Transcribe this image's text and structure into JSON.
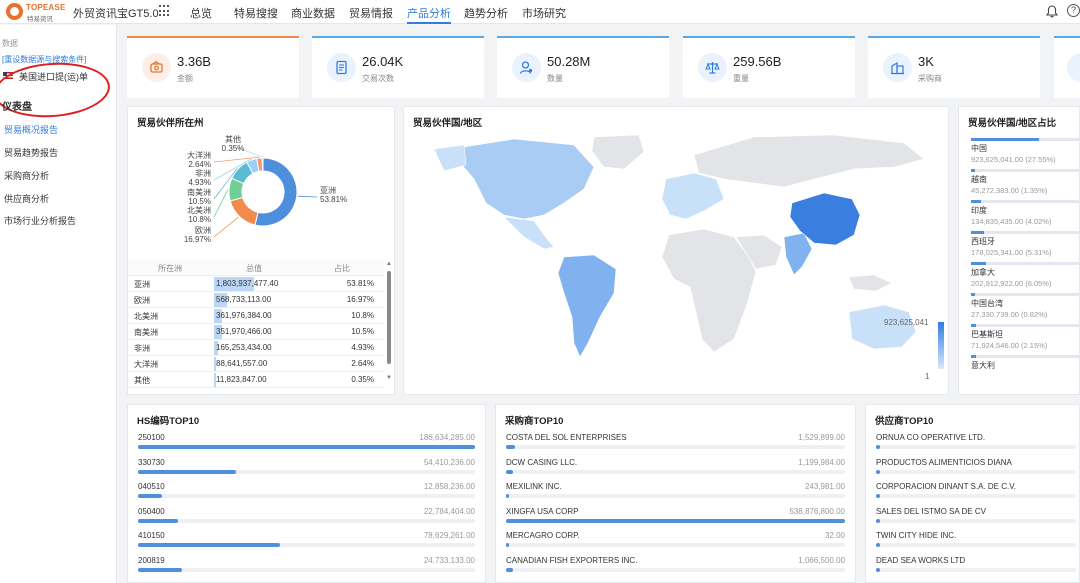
{
  "header": {
    "brand": "TOPEASE",
    "brand_cn": "特易资讯",
    "product": "外贸资讯宝GT5.0",
    "nav": [
      "总览",
      "特易搜搜",
      "商业数据",
      "贸易情报",
      "产品分析",
      "趋势分析",
      "市场研究"
    ],
    "active_nav": "产品分析",
    "help": "?"
  },
  "sidebar": {
    "data_label": "数据",
    "set_link": "[重设数据源与搜索条件]",
    "dataset": "美国进口提(运)单",
    "section": "仪表盘",
    "items": [
      "贸易概况报告",
      "贸易趋势报告",
      "采购商分析",
      "供应商分析",
      "市场行业分析报告"
    ],
    "active_item": "贸易概况报告"
  },
  "kpis": [
    {
      "value": "3.36B",
      "label": "金额",
      "icon": "money-icon"
    },
    {
      "value": "26.04K",
      "label": "交易次数",
      "icon": "document-icon"
    },
    {
      "value": "50.28M",
      "label": "数量",
      "icon": "person-icon"
    },
    {
      "value": "259.56B",
      "label": "重量",
      "icon": "scale-icon"
    },
    {
      "value": "3K",
      "label": "采购商",
      "icon": "building-icon"
    }
  ],
  "continent_panel": {
    "title": "贸易伙伴所在州",
    "table_head": [
      "所在洲",
      "总值",
      "占比"
    ],
    "rows": [
      {
        "name": "亚洲",
        "value": "1,803,937,477.40",
        "share": "53.81%"
      },
      {
        "name": "欧洲",
        "value": "568,733,113.00",
        "share": "16.97%"
      },
      {
        "name": "北美洲",
        "value": "361,976,384.00",
        "share": "10.8%"
      },
      {
        "name": "南美洲",
        "value": "351,970,466.00",
        "share": "10.5%"
      },
      {
        "name": "非洲",
        "value": "165,253,434.00",
        "share": "4.93%"
      },
      {
        "name": "大洋洲",
        "value": "88,641,557.00",
        "share": "2.64%"
      },
      {
        "name": "其他",
        "value": "11,823,847.00",
        "share": "0.35%"
      }
    ]
  },
  "chart_data": {
    "type": "pie",
    "labels": [
      "亚洲",
      "欧洲",
      "北美洲",
      "南美洲",
      "非洲",
      "大洋洲",
      "其他"
    ],
    "values": [
      53.81,
      16.97,
      10.8,
      10.5,
      4.93,
      2.64,
      0.35
    ],
    "colors": [
      "#4e8fdd",
      "#f28a4c",
      "#6fcf97",
      "#5bbbd2",
      "#9ad0f5",
      "#f49a6e",
      "#cfd8e3"
    ],
    "label_texts": {
      "亚洲": [
        "亚洲",
        "53.81%"
      ],
      "欧洲": [
        "欧洲",
        "16.97%"
      ],
      "北美洲": [
        "北美洲",
        "10.8%"
      ],
      "南美洲": [
        "南美洲",
        "10.5%"
      ],
      "非洲": [
        "非洲",
        "4.93%"
      ],
      "大洋洲": [
        "大洋洲",
        "2.64%"
      ],
      "其他": [
        "其他",
        "0.35%"
      ]
    }
  },
  "map_panel": {
    "title": "贸易伙伴国/地区",
    "legend_max": "923,625,041",
    "legend_min": "1"
  },
  "share_panel": {
    "title": "贸易伙伴国/地区占比",
    "items": [
      {
        "name": "中国",
        "value": "923,625,041.00 (27.55%)",
        "pct": 27.55
      },
      {
        "name": "越南",
        "value": "45,272,383.00 (1.35%)",
        "pct": 1.35
      },
      {
        "name": "印度",
        "value": "134,835,435.00 (4.02%)",
        "pct": 4.02
      },
      {
        "name": "西班牙",
        "value": "178,025,341.00 (5.31%)",
        "pct": 5.31
      },
      {
        "name": "加拿大",
        "value": "202,912,922.00 (6.05%)",
        "pct": 6.05
      },
      {
        "name": "中国台湾",
        "value": "27,330,739.00 (0.82%)",
        "pct": 0.82
      },
      {
        "name": "巴基斯坦",
        "value": "71,924,546.00 (2.15%)",
        "pct": 2.15
      },
      {
        "name": "意大利",
        "value": "",
        "pct": 2.2
      }
    ]
  },
  "hs_panel": {
    "title": "HS编码TOP10",
    "rows": [
      {
        "name": "250100",
        "value": "186,634,285.00",
        "pct": 100
      },
      {
        "name": "330730",
        "value": "54,410,236.00",
        "pct": 29
      },
      {
        "name": "040510",
        "value": "12,858,236.00",
        "pct": 7
      },
      {
        "name": "050400",
        "value": "22,784,404.00",
        "pct": 12
      },
      {
        "name": "410150",
        "value": "78,629,261.00",
        "pct": 42
      },
      {
        "name": "200819",
        "value": "24,733,133.00",
        "pct": 13
      }
    ]
  },
  "buyer_panel": {
    "title": "采购商TOP10",
    "rows": [
      {
        "name": "COSTA DEL SOL ENTERPRISES",
        "value": "1,529,899.00",
        "pct": 2.8
      },
      {
        "name": "DCW CASING LLC.",
        "value": "1,199,984.00",
        "pct": 2.2
      },
      {
        "name": "MEXILINK INC.",
        "value": "243,981.00",
        "pct": 0.5
      },
      {
        "name": "XINGFA USA CORP",
        "value": "538,876,800.00",
        "pct": 100
      },
      {
        "name": "MERCAGRO CORP.",
        "value": "32.00",
        "pct": 0.1
      },
      {
        "name": "CANADIAN FISH EXPORTERS INC.",
        "value": "1,066,500.00",
        "pct": 2
      }
    ]
  },
  "supplier_panel": {
    "title": "供应商TOP10",
    "rows": [
      {
        "name": "ORNUA CO OPERATIVE LTD."
      },
      {
        "name": "PRODUCTOS ALIMENTICIOS DIANA"
      },
      {
        "name": "CORPORACION DINANT S.A. DE C.V."
      },
      {
        "name": "SALES DEL ISTMO SA DE CV"
      },
      {
        "name": "TWIN CITY HIDE INC."
      },
      {
        "name": "DEAD SEA WORKS LTD"
      }
    ]
  }
}
